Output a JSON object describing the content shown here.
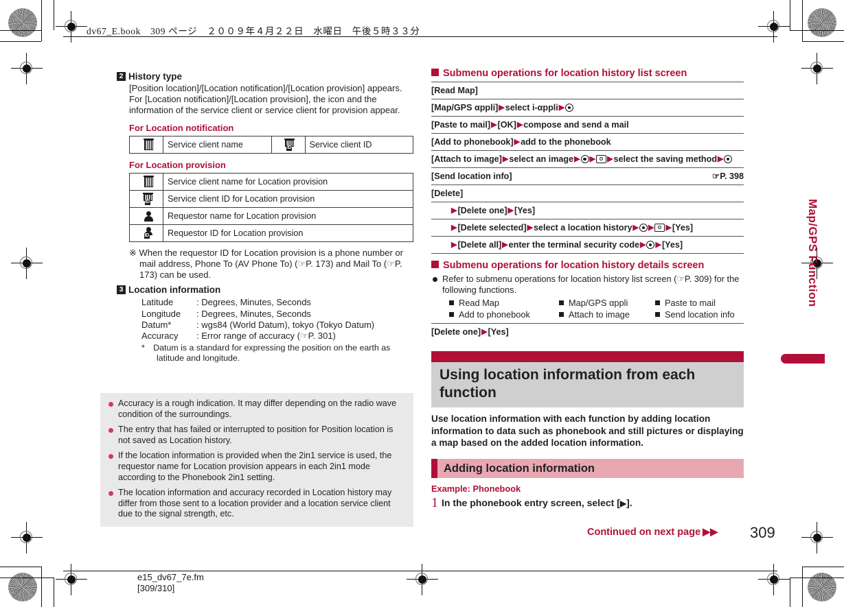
{
  "header": {
    "text": "dv67_E.book　309 ページ　２００９年４月２２日　水曜日　午後５時３３分"
  },
  "side_tab": {
    "label": "Map/GPS Function"
  },
  "left_column": {
    "item2": {
      "number": "2",
      "title": "History type",
      "body": "[Position location]/[Location notification]/[Location provision] appears. For [Location notification]/[Location provision], the icon and the information of the service client or service client for provision appear.",
      "sub1_title": "For Location notification",
      "table1": [
        {
          "icon": "building-icon",
          "label": "Service client name",
          "icon2": "building-id-icon",
          "label2": "Service client ID"
        }
      ],
      "sub2_title": "For Location provision",
      "table2": [
        {
          "icon": "building-icon",
          "label": "Service client name for Location provision"
        },
        {
          "icon": "building-id-icon",
          "label": "Service client ID for Location provision"
        },
        {
          "icon": "person-icon",
          "label": "Requestor name for Location provision"
        },
        {
          "icon": "person-id-icon",
          "label": "Requestor ID for Location provision"
        }
      ],
      "note": "※ When the requestor ID for Location provision is a phone number or mail address, Phone To (AV Phone To) (☞P. 173) and Mail To (☞P. 173) can be used."
    },
    "item3": {
      "number": "3",
      "title": "Location information",
      "specs": [
        {
          "label": "Latitude",
          "value": ": Degrees, Minutes, Seconds"
        },
        {
          "label": "Longitude",
          "value": ": Degrees, Minutes, Seconds"
        },
        {
          "label": "Datum*",
          "value": ": wgs84 (World Datum), tokyo (Tokyo Datum)"
        },
        {
          "label": "Accuracy",
          "value": ": Error range of accuracy (☞P. 301)"
        }
      ],
      "footnote": "*　Datum is a standard for expressing the position on the earth as latitude and longitude."
    },
    "notes": [
      "Accuracy is a rough indication. It may differ depending on the radio wave condition of the surroundings.",
      "The entry that has failed or interrupted to position for Position location is not saved as Location history.",
      "If the location information is provided when the 2in1 service is used, the requestor name for Location provision appears in each 2in1 mode according to the Phonebook 2in1 setting.",
      "The location information and accuracy recorded in Location history may differ from those sent to a location provider and a location service client due to the signal strength, etc."
    ]
  },
  "right_column": {
    "list_screen": {
      "heading": "Submenu operations for location history list screen",
      "rows": [
        {
          "id": "read-map",
          "parts": [
            {
              "t": "text",
              "v": "[Read Map]"
            }
          ]
        },
        {
          "id": "map-gps-appli",
          "parts": [
            {
              "t": "text",
              "v": "[Map/GPS αppli]"
            },
            {
              "t": "tri"
            },
            {
              "t": "text",
              "v": "select i-αppli"
            },
            {
              "t": "tri"
            },
            {
              "t": "key"
            }
          ]
        },
        {
          "id": "paste-to-mail",
          "parts": [
            {
              "t": "text",
              "v": "[Paste to mail]"
            },
            {
              "t": "tri"
            },
            {
              "t": "text",
              "v": "[OK]"
            },
            {
              "t": "tri"
            },
            {
              "t": "text",
              "v": "compose and send a mail"
            }
          ]
        },
        {
          "id": "add-to-phonebook",
          "parts": [
            {
              "t": "text",
              "v": "[Add to phonebook]"
            },
            {
              "t": "tri"
            },
            {
              "t": "text",
              "v": "add to the phonebook"
            }
          ]
        },
        {
          "id": "attach-to-image",
          "parts": [
            {
              "t": "text",
              "v": "[Attach to image]"
            },
            {
              "t": "tri"
            },
            {
              "t": "text",
              "v": "select an image"
            },
            {
              "t": "tri"
            },
            {
              "t": "key"
            },
            {
              "t": "tri"
            },
            {
              "t": "cam"
            },
            {
              "t": "tri"
            },
            {
              "t": "text",
              "v": "select the saving method"
            },
            {
              "t": "tri"
            },
            {
              "t": "key"
            }
          ]
        },
        {
          "id": "send-location-info",
          "parts": [
            {
              "t": "text",
              "v": "[Send location info]"
            }
          ],
          "ref": "☞P. 398"
        },
        {
          "id": "delete",
          "parts": [
            {
              "t": "text",
              "v": "[Delete]"
            }
          ]
        },
        {
          "id": "delete-one",
          "indent": true,
          "parts": [
            {
              "t": "tri"
            },
            {
              "t": "text",
              "v": "[Delete one]"
            },
            {
              "t": "tri"
            },
            {
              "t": "text",
              "v": "[Yes]"
            }
          ]
        },
        {
          "id": "delete-selected",
          "indent": true,
          "parts": [
            {
              "t": "tri"
            },
            {
              "t": "text",
              "v": "[Delete selected]"
            },
            {
              "t": "tri"
            },
            {
              "t": "text",
              "v": "select a location history"
            },
            {
              "t": "tri"
            },
            {
              "t": "key"
            },
            {
              "t": "tri"
            },
            {
              "t": "cam"
            },
            {
              "t": "tri"
            },
            {
              "t": "text",
              "v": "[Yes]"
            }
          ]
        },
        {
          "id": "delete-all",
          "indent": true,
          "parts": [
            {
              "t": "tri"
            },
            {
              "t": "text",
              "v": "[Delete all]"
            },
            {
              "t": "tri"
            },
            {
              "t": "text",
              "v": "enter the terminal security code"
            },
            {
              "t": "tri"
            },
            {
              "t": "key"
            },
            {
              "t": "tri"
            },
            {
              "t": "text",
              "v": "[Yes]"
            }
          ]
        }
      ]
    },
    "details_screen": {
      "heading": "Submenu operations for location history details screen",
      "bullet": "Refer to submenu operations for location history list screen (☞P. 309) for the following functions.",
      "functions": [
        "Read Map",
        "Map/GPS αppli",
        "Paste to mail",
        "Add to phonebook",
        "Attach to image",
        "Send location info"
      ],
      "row": {
        "id": "delete-one-details",
        "parts": [
          {
            "t": "text",
            "v": "[Delete one]"
          },
          {
            "t": "tri"
          },
          {
            "t": "text",
            "v": "[Yes]"
          }
        ]
      }
    },
    "section": {
      "title": "Using location information from each function",
      "body": "Use location information with each function by adding location information to data such as phonebook and still pictures or displaying a map based on the added location information.",
      "subsection_title": "Adding location information",
      "example_label": "Example: Phonebook",
      "step_number": "1",
      "step_text_before": "In the phonebook entry screen, select [",
      "step_text_after": "]."
    }
  },
  "footer": {
    "continued": "Continued on next page",
    "continued_arrow": "▶▶",
    "page_number": "309",
    "fm_file": "e15_dv67_7e.fm",
    "fm_pages": "[309/310]"
  },
  "colors": {
    "accent_red": "#b01038",
    "banner_grey": "#cfcfcf",
    "subbanner_pink": "#e8a8b1",
    "note_grey": "#e9e9e9"
  }
}
